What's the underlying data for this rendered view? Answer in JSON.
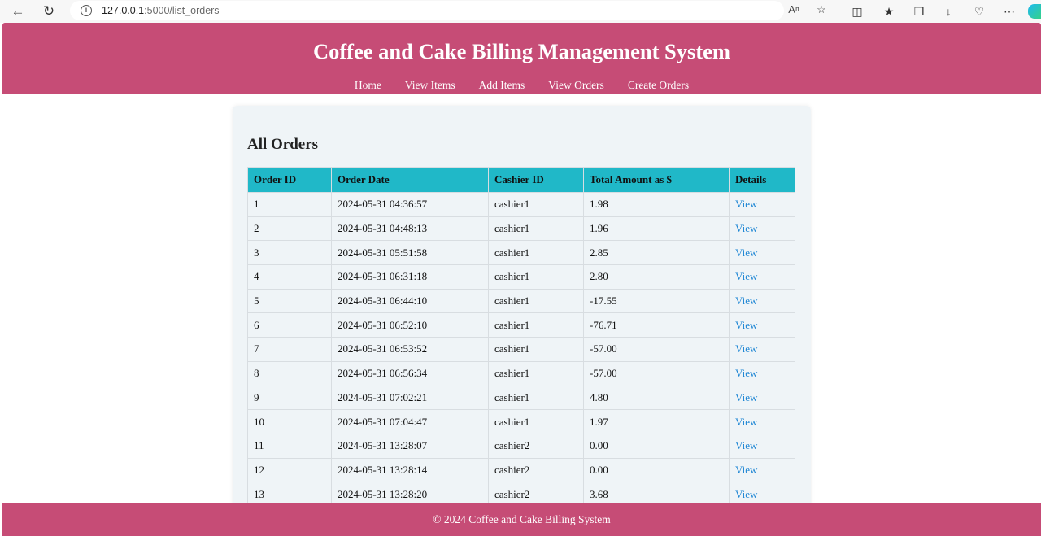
{
  "browser": {
    "url_host": "127.0.0.1",
    "url_rest": ":5000/list_orders"
  },
  "header": {
    "title": "Coffee and Cake Billing Management System",
    "nav": [
      "Home",
      "View Items",
      "Add Items",
      "View Orders",
      "Create Orders"
    ]
  },
  "main": {
    "title": "All Orders",
    "columns": [
      "Order ID",
      "Order Date",
      "Cashier ID",
      "Total Amount as $",
      "Details"
    ],
    "rows": [
      [
        "1",
        "2024-05-31 04:36:57",
        "cashier1",
        "1.98",
        "View"
      ],
      [
        "2",
        "2024-05-31 04:48:13",
        "cashier1",
        "1.96",
        "View"
      ],
      [
        "3",
        "2024-05-31 05:51:58",
        "cashier1",
        "2.85",
        "View"
      ],
      [
        "4",
        "2024-05-31 06:31:18",
        "cashier1",
        "2.80",
        "View"
      ],
      [
        "5",
        "2024-05-31 06:44:10",
        "cashier1",
        "-17.55",
        "View"
      ],
      [
        "6",
        "2024-05-31 06:52:10",
        "cashier1",
        "-76.71",
        "View"
      ],
      [
        "7",
        "2024-05-31 06:53:52",
        "cashier1",
        "-57.00",
        "View"
      ],
      [
        "8",
        "2024-05-31 06:56:34",
        "cashier1",
        "-57.00",
        "View"
      ],
      [
        "9",
        "2024-05-31 07:02:21",
        "cashier1",
        "4.80",
        "View"
      ],
      [
        "10",
        "2024-05-31 07:04:47",
        "cashier1",
        "1.97",
        "View"
      ],
      [
        "11",
        "2024-05-31 13:28:07",
        "cashier2",
        "0.00",
        "View"
      ],
      [
        "12",
        "2024-05-31 13:28:14",
        "cashier2",
        "0.00",
        "View"
      ],
      [
        "13",
        "2024-05-31 13:28:20",
        "cashier2",
        "3.68",
        "View"
      ]
    ]
  },
  "footer": {
    "text": "© 2024 Coffee and Cake Billing System"
  },
  "colors": {
    "brand": "#c64c76",
    "table_header": "#20b8c8",
    "link": "#1e86d4",
    "card_bg": "#eff4f7"
  }
}
